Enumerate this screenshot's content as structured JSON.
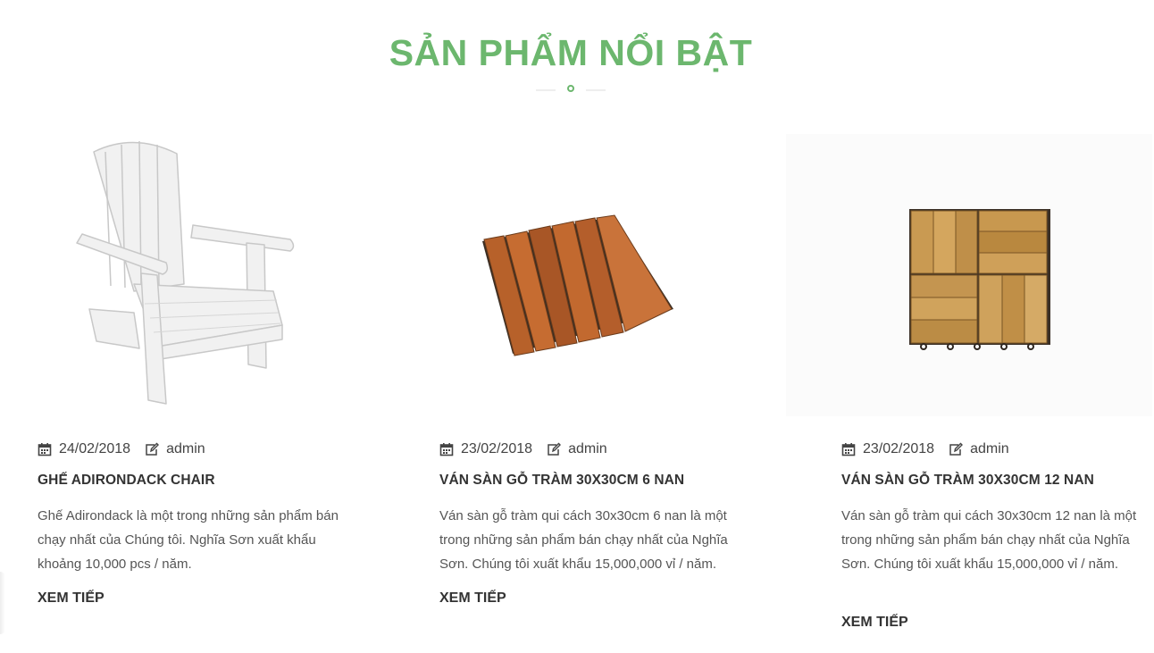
{
  "section": {
    "title": "SẢN PHẨM NỔI BẬT",
    "accent_color": "#6cb76e"
  },
  "products": [
    {
      "date": "24/02/2018",
      "author": "admin",
      "title": "GHẾ ADIRONDACK CHAIR",
      "excerpt": "Ghế Adirondack là một trong những sản phẩm bán chạy nhất của Chúng tôi. Nghĩa Sơn xuất khẩu khoảng 10,000 pcs / năm.",
      "read_more": "XEM TIẾP",
      "image": "adirondack-chair-image"
    },
    {
      "date": "23/02/2018",
      "author": "admin",
      "title": "VÁN SÀN GỖ TRÀM 30X30CM 6 NAN",
      "excerpt": "Ván sàn gỗ tràm qui cách 30x30cm 6 nan là một trong những sản phẩm bán chạy nhất của Nghĩa Sơn. Chúng tôi xuất khẩu 15,000,000 vỉ / năm.",
      "read_more": "XEM TIẾP",
      "image": "deck-tile-6-slat-image"
    },
    {
      "date": "23/02/2018",
      "author": "admin",
      "title": "VÁN SÀN GỖ TRÀM 30X30CM 12 NAN",
      "excerpt": "Ván sàn gỗ tràm qui cách 30x30cm 12 nan là một trong những sản phẩm bán chạy nhất của Nghĩa Sơn. Chúng tôi xuất khẩu 15,000,000 vỉ / năm.",
      "read_more": "XEM TIẾP",
      "image": "deck-tile-12-slat-image"
    }
  ],
  "icons": {
    "date": "calendar-icon",
    "author": "edit-icon"
  }
}
